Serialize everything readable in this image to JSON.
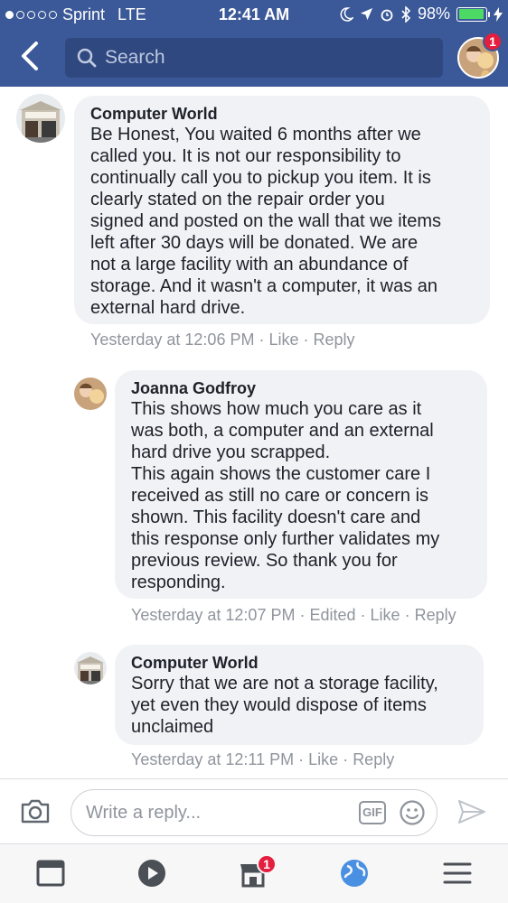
{
  "status_bar": {
    "carrier": "Sprint",
    "network": "LTE",
    "time": "12:41 AM",
    "battery": "98%"
  },
  "header": {
    "search_placeholder": "Search",
    "notification_count": "1",
    "icons": [
      "back-chevron-icon",
      "search-icon"
    ]
  },
  "comments": [
    {
      "author": "Computer World",
      "text": "Be Honest, You waited 6 months after we\ncalled you. It is not our responsibility to\ncontinually call you to pickup you item. It is\nclearly stated on the repair order you\nsigned and posted on the wall that we items\nleft after 30 days will be donated. We are\nnot a large facility with an abundance of\nstorage. And it wasn't a computer, it was an\nexternal hard drive.",
      "time": "Yesterday at 12:06 PM",
      "edited": "",
      "like": "Like",
      "reply": "Reply"
    },
    {
      "author": "Joanna Godfroy",
      "text": "This shows how much you care as it\nwas both, a computer and an external\nhard drive you scrapped.\nThis again shows the customer care I\nreceived as still no care or concern is\nshown. This facility doesn't care and\nthis response only further validates my\nprevious review. So thank you for\nresponding.",
      "time": "Yesterday at 12:07 PM",
      "edited": "Edited",
      "like": "Like",
      "reply": "Reply"
    },
    {
      "author": "Computer World",
      "text": "Sorry that we are not a storage facility,\nyet even they would dispose of items\nunclaimed",
      "time": "Yesterday at 12:11 PM",
      "edited": "",
      "like": "Like",
      "reply": "Reply"
    }
  ],
  "reply_bar": {
    "placeholder": "Write a reply...",
    "gif_label": "GIF",
    "icons": [
      "camera-icon",
      "smiley-icon",
      "send-icon"
    ]
  },
  "tab_bar": {
    "tabs": [
      "news-feed",
      "watch",
      "marketplace",
      "notifications",
      "menu"
    ],
    "marketplace_badge": "1"
  },
  "colors": {
    "brand_blue": "#3b5998",
    "bubble_gray": "#f1f2f5",
    "meta_gray": "#90949c",
    "badge_red": "#e41e3f",
    "active_tab": "#4a90e2"
  }
}
